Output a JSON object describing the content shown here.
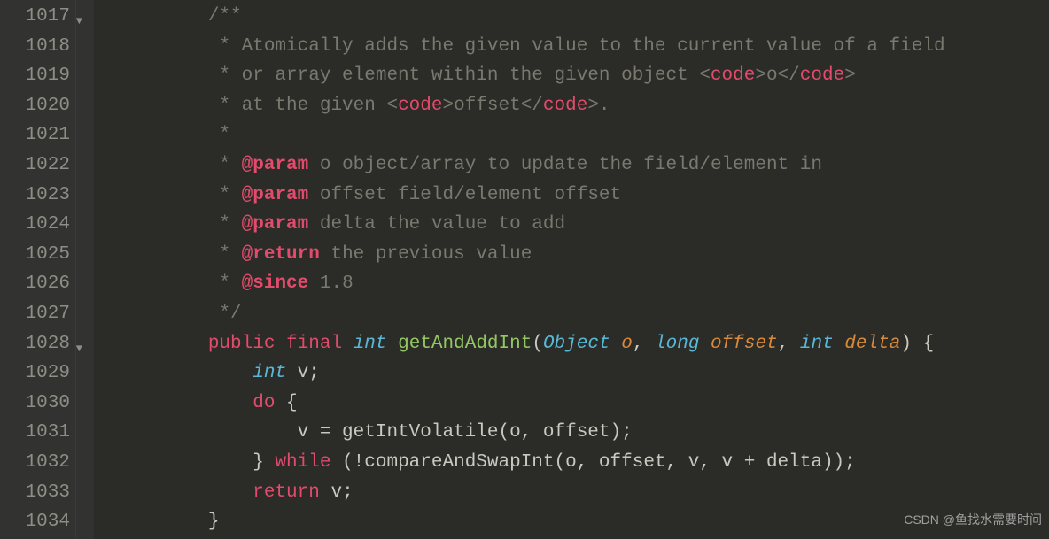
{
  "gutter": {
    "start": 1017,
    "foldable": [
      1017,
      1028
    ],
    "lines": [
      1017,
      1018,
      1019,
      1020,
      1021,
      1022,
      1023,
      1024,
      1025,
      1026,
      1027,
      1028,
      1029,
      1030,
      1031,
      1032,
      1033,
      1034
    ]
  },
  "watermark": "CSDN @鱼找水需要时间",
  "code": {
    "lines": [
      {
        "n": 1017,
        "indent": "        ",
        "tokens": [
          {
            "cls": "c-comment",
            "t": "/**"
          }
        ]
      },
      {
        "n": 1018,
        "indent": "         ",
        "tokens": [
          {
            "cls": "c-comment",
            "t": "* Atomically adds the given value to the current value of a field"
          }
        ]
      },
      {
        "n": 1019,
        "indent": "         ",
        "tokens": [
          {
            "cls": "c-comment",
            "t": "* or array element within the given object "
          },
          {
            "cls": "c-comment",
            "t": "<"
          },
          {
            "cls": "c-tag",
            "t": "code"
          },
          {
            "cls": "c-comment",
            "t": ">o</"
          },
          {
            "cls": "c-tag",
            "t": "code"
          },
          {
            "cls": "c-comment",
            "t": ">"
          }
        ]
      },
      {
        "n": 1020,
        "indent": "         ",
        "tokens": [
          {
            "cls": "c-comment",
            "t": "* at the given "
          },
          {
            "cls": "c-comment",
            "t": "<"
          },
          {
            "cls": "c-tag",
            "t": "code"
          },
          {
            "cls": "c-comment",
            "t": ">offset</"
          },
          {
            "cls": "c-tag",
            "t": "code"
          },
          {
            "cls": "c-comment",
            "t": ">."
          }
        ]
      },
      {
        "n": 1021,
        "indent": "         ",
        "tokens": [
          {
            "cls": "c-comment",
            "t": "*"
          }
        ]
      },
      {
        "n": 1022,
        "indent": "         ",
        "tokens": [
          {
            "cls": "c-comment",
            "t": "* "
          },
          {
            "cls": "c-doctag",
            "t": "@param"
          },
          {
            "cls": "c-comment",
            "t": " o object/array to update the field/element in"
          }
        ]
      },
      {
        "n": 1023,
        "indent": "         ",
        "tokens": [
          {
            "cls": "c-comment",
            "t": "* "
          },
          {
            "cls": "c-doctag",
            "t": "@param"
          },
          {
            "cls": "c-comment",
            "t": " offset field/element offset"
          }
        ]
      },
      {
        "n": 1024,
        "indent": "         ",
        "tokens": [
          {
            "cls": "c-comment",
            "t": "* "
          },
          {
            "cls": "c-doctag",
            "t": "@param"
          },
          {
            "cls": "c-comment",
            "t": " delta the value to add"
          }
        ]
      },
      {
        "n": 1025,
        "indent": "         ",
        "tokens": [
          {
            "cls": "c-comment",
            "t": "* "
          },
          {
            "cls": "c-doctag",
            "t": "@return"
          },
          {
            "cls": "c-comment",
            "t": " the previous value"
          }
        ]
      },
      {
        "n": 1026,
        "indent": "         ",
        "tokens": [
          {
            "cls": "c-comment",
            "t": "* "
          },
          {
            "cls": "c-doctag",
            "t": "@since"
          },
          {
            "cls": "c-comment",
            "t": " 1.8"
          }
        ]
      },
      {
        "n": 1027,
        "indent": "         ",
        "tokens": [
          {
            "cls": "c-comment",
            "t": "*/"
          }
        ]
      },
      {
        "n": 1028,
        "indent": "        ",
        "tokens": [
          {
            "cls": "c-kw",
            "t": "public"
          },
          {
            "cls": "c-plain",
            "t": " "
          },
          {
            "cls": "c-kw",
            "t": "final"
          },
          {
            "cls": "c-plain",
            "t": " "
          },
          {
            "cls": "c-type",
            "t": "int"
          },
          {
            "cls": "c-plain",
            "t": " "
          },
          {
            "cls": "c-fn",
            "t": "getAndAddInt"
          },
          {
            "cls": "c-punct",
            "t": "("
          },
          {
            "cls": "c-cls",
            "t": "Object"
          },
          {
            "cls": "c-plain",
            "t": " "
          },
          {
            "cls": "c-param",
            "t": "o"
          },
          {
            "cls": "c-punct",
            "t": ", "
          },
          {
            "cls": "c-type",
            "t": "long"
          },
          {
            "cls": "c-plain",
            "t": " "
          },
          {
            "cls": "c-param",
            "t": "offset"
          },
          {
            "cls": "c-punct",
            "t": ", "
          },
          {
            "cls": "c-type",
            "t": "int"
          },
          {
            "cls": "c-plain",
            "t": " "
          },
          {
            "cls": "c-param",
            "t": "delta"
          },
          {
            "cls": "c-punct",
            "t": ") {"
          }
        ]
      },
      {
        "n": 1029,
        "indent": "            ",
        "tokens": [
          {
            "cls": "c-type",
            "t": "int"
          },
          {
            "cls": "c-plain",
            "t": " v;"
          }
        ]
      },
      {
        "n": 1030,
        "indent": "            ",
        "tokens": [
          {
            "cls": "c-kw",
            "t": "do"
          },
          {
            "cls": "c-plain",
            "t": " {"
          }
        ]
      },
      {
        "n": 1031,
        "indent": "                ",
        "tokens": [
          {
            "cls": "c-plain",
            "t": "v = getIntVolatile(o, offset);"
          }
        ]
      },
      {
        "n": 1032,
        "indent": "            ",
        "tokens": [
          {
            "cls": "c-plain",
            "t": "} "
          },
          {
            "cls": "c-kw",
            "t": "while"
          },
          {
            "cls": "c-plain",
            "t": " (!compareAndSwapInt(o, offset, v, v + delta));"
          }
        ]
      },
      {
        "n": 1033,
        "indent": "            ",
        "tokens": [
          {
            "cls": "c-kw",
            "t": "return"
          },
          {
            "cls": "c-plain",
            "t": " v;"
          }
        ]
      },
      {
        "n": 1034,
        "indent": "        ",
        "tokens": [
          {
            "cls": "c-plain",
            "t": "}"
          }
        ]
      }
    ]
  }
}
